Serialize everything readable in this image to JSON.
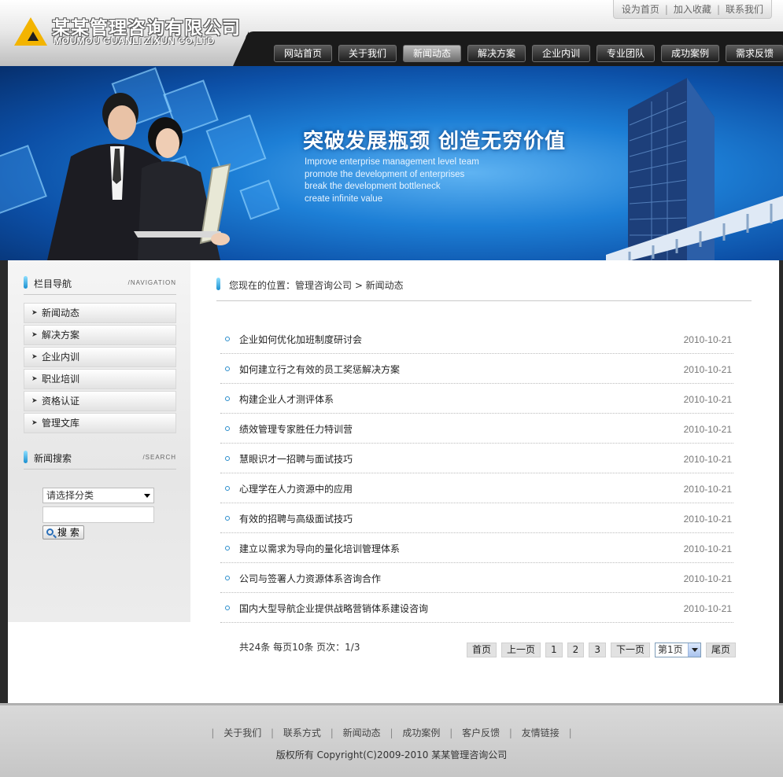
{
  "brand": {
    "name_cn": "某某管理咨询有限公司",
    "name_en": "MOUMOU GUANLI ZIXUN CO,LTD"
  },
  "toplinks": [
    "设为首页",
    "加入收藏",
    "联系我们"
  ],
  "nav": [
    {
      "label": "网站首页",
      "active": false
    },
    {
      "label": "关于我们",
      "active": false
    },
    {
      "label": "新闻动态",
      "active": true
    },
    {
      "label": "解决方案",
      "active": false
    },
    {
      "label": "企业内训",
      "active": false
    },
    {
      "label": "专业团队",
      "active": false
    },
    {
      "label": "成功案例",
      "active": false
    },
    {
      "label": "需求反馈",
      "active": false
    }
  ],
  "banner": {
    "title": "突破发展瓶颈 创造无穷价值",
    "lines": [
      "Improve enterprise management level team",
      "promote the development of enterprises",
      "break the development bottleneck",
      "create infinite value"
    ]
  },
  "sidebar": {
    "nav_title": "栏目导航",
    "nav_en": "/NAVIGATION",
    "items": [
      "新闻动态",
      "解决方案",
      "企业内训",
      "职业培训",
      "资格认证",
      "管理文库"
    ],
    "search_title": "新闻搜索",
    "search_en": "/SEARCH",
    "select_value": "请选择分类",
    "search_button": "搜 索"
  },
  "breadcrumb": "您现在的位置：管理咨询公司 > 新闻动态",
  "news": [
    {
      "title": "企业如何优化加班制度研讨会",
      "date": "2010-10-21"
    },
    {
      "title": "如何建立行之有效的员工奖惩解决方案",
      "date": "2010-10-21"
    },
    {
      "title": "构建企业人才测评体系",
      "date": "2010-10-21"
    },
    {
      "title": "绩效管理专家胜任力特训营",
      "date": "2010-10-21"
    },
    {
      "title": "慧眼识才一招聘与面试技巧",
      "date": "2010-10-21"
    },
    {
      "title": "心理学在人力资源中的应用",
      "date": "2010-10-21"
    },
    {
      "title": "有效的招聘与高级面试技巧",
      "date": "2010-10-21"
    },
    {
      "title": "建立以需求为导向的量化培训管理体系",
      "date": "2010-10-21"
    },
    {
      "title": "公司与签署人力资源体系咨询合作",
      "date": "2010-10-21"
    },
    {
      "title": "国内大型导航企业提供战略营销体系建设咨询",
      "date": "2010-10-21"
    }
  ],
  "pager": {
    "info": "共24条  每页10条  页次：1/3",
    "first": "首页",
    "prev": "上一页",
    "pages": [
      "1",
      "2",
      "3"
    ],
    "next": "下一页",
    "select_value": "第1页",
    "last": "尾页"
  },
  "footer": {
    "links": [
      "关于我们",
      "联系方式",
      "新闻动态",
      "成功案例",
      "客户反馈",
      "友情链接"
    ],
    "copyright": "版权所有  Copyright(C)2009-2010 某某管理咨询公司"
  },
  "colors": {
    "accent_blue": "#1a8fd0",
    "logo_yellow": "#f3b400",
    "nav_dark": "#1a1a1a"
  }
}
